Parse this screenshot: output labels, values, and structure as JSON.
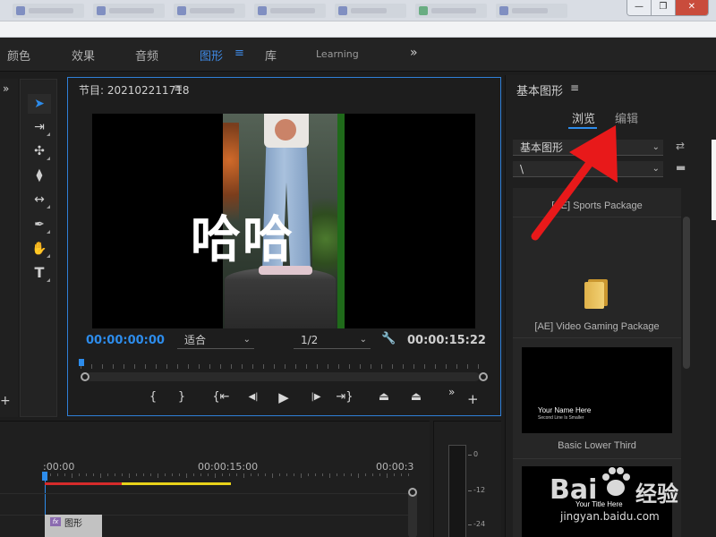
{
  "window": {
    "minimize_glyph": "—",
    "restore_glyph": "❐",
    "close_glyph": "✕"
  },
  "workspace": {
    "tabs": [
      {
        "label": "颜色"
      },
      {
        "label": "效果"
      },
      {
        "label": "音频"
      },
      {
        "label": "图形",
        "active": true
      },
      {
        "label": "库"
      },
      {
        "label": "Learning"
      }
    ],
    "menu_glyph": "≡",
    "more_glyph": "»"
  },
  "tools": {
    "collapse_glyph": "»",
    "items": [
      {
        "name": "selection-tool",
        "glyph": "➤"
      },
      {
        "name": "track-select-tool",
        "glyph": "⇥"
      },
      {
        "name": "ripple-edit-tool",
        "glyph": "✣"
      },
      {
        "name": "razor-tool",
        "glyph": "⧫"
      },
      {
        "name": "slip-tool",
        "glyph": "↔"
      },
      {
        "name": "pen-tool",
        "glyph": "✒"
      },
      {
        "name": "hand-tool",
        "glyph": "✋"
      },
      {
        "name": "type-tool",
        "glyph": "T"
      }
    ],
    "add_glyph": "+"
  },
  "program_monitor": {
    "title": "节目: 202102211718",
    "menu_glyph": "≡",
    "overlay_text": "哈哈",
    "current_timecode": "00:00:00:00",
    "zoom_select": "适合",
    "resolution_select": "1/2",
    "duration_timecode": "00:00:15:22",
    "controls": [
      {
        "name": "mark-in-button",
        "glyph": "{"
      },
      {
        "name": "mark-out-button",
        "glyph": "}"
      },
      {
        "name": "go-to-in-button",
        "glyph": "{⇤"
      },
      {
        "name": "step-back-button",
        "glyph": "◀|"
      },
      {
        "name": "play-button",
        "glyph": "▶"
      },
      {
        "name": "step-forward-button",
        "glyph": "|▶"
      },
      {
        "name": "go-to-out-button",
        "glyph": "⇥}"
      },
      {
        "name": "lift-button",
        "glyph": "⏏"
      },
      {
        "name": "extract-button",
        "glyph": "⏏"
      }
    ],
    "more_glyph": "»",
    "add_glyph": "+"
  },
  "essential_graphics": {
    "title": "基本图形",
    "menu_glyph": "≡",
    "tabs": {
      "browse": "浏览",
      "edit": "编辑"
    },
    "select_1": "基本图形",
    "select_2": "\\",
    "items": [
      {
        "label": "[AE] Sports Package"
      },
      {
        "label": "[AE] Video Gaming Package"
      },
      {
        "label": "Basic Lower Third",
        "thumb_title": "Your Name Here",
        "thumb_sub": "Second Line Is Smaller"
      },
      {
        "label": "",
        "thumb_title": "Your Title Here"
      }
    ]
  },
  "timeline": {
    "timecodes": [
      ":00:00",
      "00:00:15:00",
      "00:00:3"
    ],
    "clip_label": "图形",
    "fx_badge": "fx"
  },
  "audio_meter": {
    "db_labels": [
      "0",
      "-12",
      "-24"
    ]
  },
  "watermark": {
    "logo": "Bai",
    "logo_cn": "经验",
    "url": "jingyan.baidu.com"
  },
  "colors": {
    "accent": "#2d8ceb",
    "arrow": "#e8191a",
    "inout_red": "#d62b2b",
    "inout_yellow": "#e8d21a"
  }
}
